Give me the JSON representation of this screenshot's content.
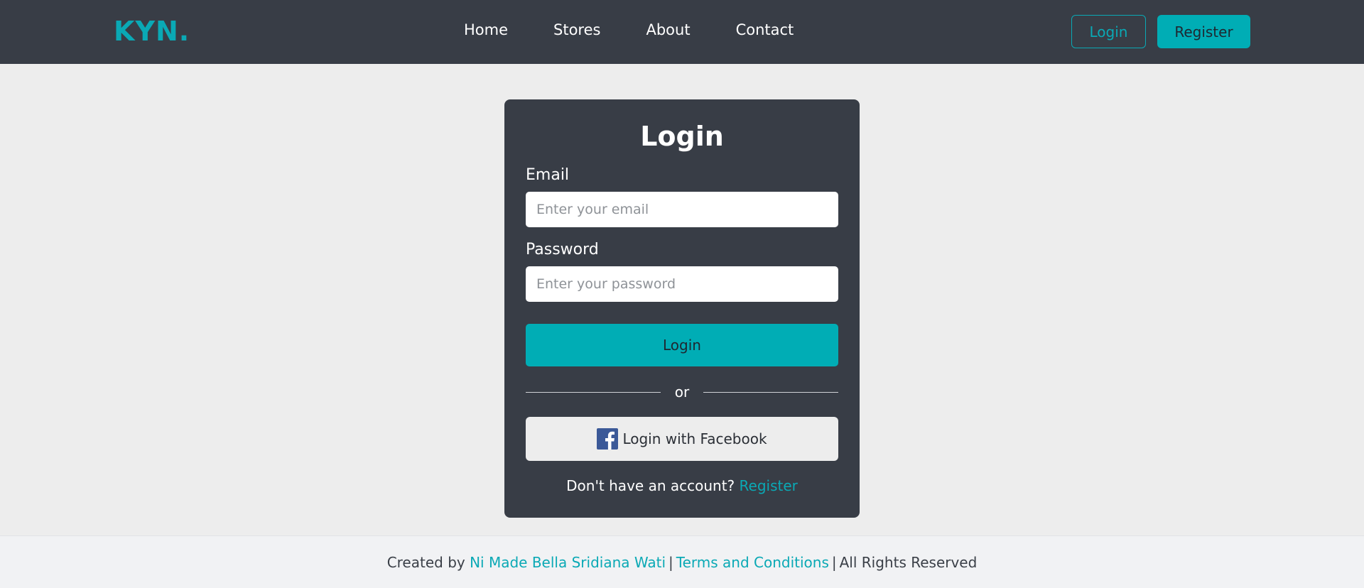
{
  "brand": {
    "logo_text": "KYN."
  },
  "nav": {
    "links": [
      {
        "label": "Home"
      },
      {
        "label": "Stores"
      },
      {
        "label": "About"
      },
      {
        "label": "Contact"
      }
    ],
    "login_label": "Login",
    "register_label": "Register"
  },
  "login_card": {
    "title": "Login",
    "email": {
      "label": "Email",
      "placeholder": "Enter your email",
      "value": ""
    },
    "password": {
      "label": "Password",
      "placeholder": "Enter your password",
      "value": ""
    },
    "submit_label": "Login",
    "divider_text": "or",
    "facebook_label": "Login with Facebook",
    "facebook_icon": "facebook-icon",
    "register_prompt": "Don't have an account?",
    "register_link": "Register"
  },
  "footer": {
    "created_by": "Created by",
    "author": "Ni Made Bella Sridiana Wati",
    "separator": "|",
    "terms": "Terms and Conditions",
    "rights": "All Rights Reserved"
  },
  "colors": {
    "accent": "#00adb5",
    "navbar_bg": "#383d46",
    "page_bg": "#ededed",
    "facebook_blue": "#3b5998"
  }
}
